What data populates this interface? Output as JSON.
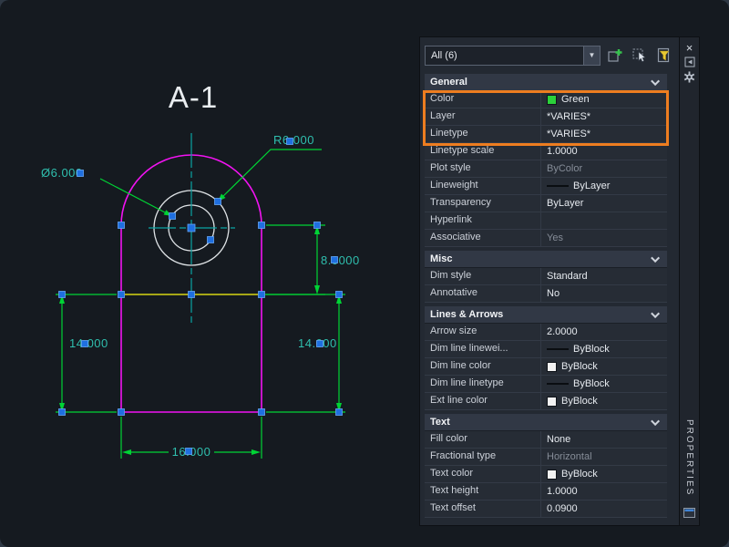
{
  "canvas": {
    "labels": {
      "title": "A-1",
      "radius": "R6.000",
      "diameter": "Ø6.000",
      "height_upper": "8.0000",
      "side_left": "14.000",
      "side_right": "14.000",
      "bottom": "16.000"
    },
    "colors": {
      "background": "#151a20",
      "outline_magenta": "#f213f2",
      "dimension_green": "#00d435",
      "dimension_text_teal": "#2fbfae",
      "centerline_teal": "#0aa3a3",
      "circle_white": "#dfe3e6",
      "highlight_yellow": "#d6d413",
      "grip_blue": "#1f6fe0"
    }
  },
  "palette": {
    "selector": {
      "value": "All (6)"
    },
    "toolbar": {
      "pickadd_toggle": "pickadd-toggle",
      "select_objects": "select-objects",
      "quick_select": "quick-select"
    },
    "titlebar": {
      "title": "PROPERTIES"
    },
    "highlight_color": "#ed7d20",
    "sections": [
      {
        "title": "General",
        "rows": [
          {
            "label": "Color",
            "value": "Green",
            "swatch": "#2bd13a",
            "highlighted": true
          },
          {
            "label": "Layer",
            "value": "*VARIES*",
            "highlighted": true
          },
          {
            "label": "Linetype",
            "value": "*VARIES*",
            "highlighted": true
          },
          {
            "label": "Linetype scale",
            "value": "1.0000"
          },
          {
            "label": "Plot style",
            "value": "ByColor",
            "muted": true
          },
          {
            "label": "Lineweight",
            "value": "ByLayer",
            "line_sample": true
          },
          {
            "label": "Transparency",
            "value": "ByLayer"
          },
          {
            "label": "Hyperlink",
            "value": ""
          },
          {
            "label": "Associative",
            "value": "Yes",
            "muted": true
          }
        ]
      },
      {
        "title": "Misc",
        "rows": [
          {
            "label": "Dim style",
            "value": "Standard"
          },
          {
            "label": "Annotative",
            "value": "No"
          }
        ]
      },
      {
        "title": "Lines & Arrows",
        "rows": [
          {
            "label": "Arrow size",
            "value": "2.0000"
          },
          {
            "label": "Dim line linewei...",
            "value": "ByBlock",
            "line_sample": true
          },
          {
            "label": "Dim line color",
            "value": "ByBlock",
            "swatch": "#f2f2f2"
          },
          {
            "label": "Dim line linetype",
            "value": "ByBlock",
            "line_sample": true
          },
          {
            "label": "Ext line color",
            "value": "ByBlock",
            "swatch": "#f2f2f2"
          }
        ]
      },
      {
        "title": "Text",
        "rows": [
          {
            "label": "Fill color",
            "value": "None"
          },
          {
            "label": "Fractional type",
            "value": "Horizontal",
            "muted": true
          },
          {
            "label": "Text color",
            "value": "ByBlock",
            "swatch": "#f2f2f2"
          },
          {
            "label": "Text height",
            "value": "1.0000"
          },
          {
            "label": "Text offset",
            "value": "0.0900"
          }
        ]
      }
    ]
  }
}
